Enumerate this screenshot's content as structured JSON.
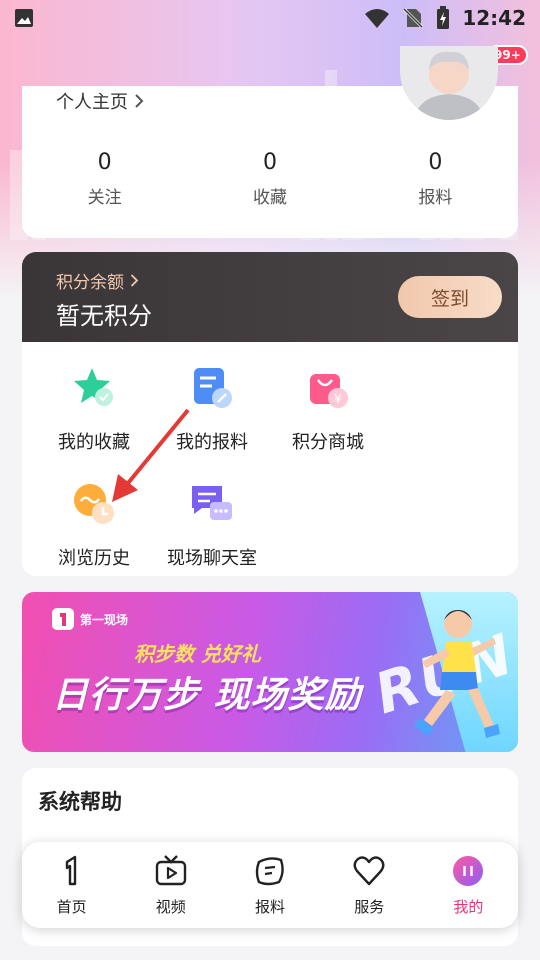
{
  "status_bar": {
    "time": "12:42"
  },
  "header": {
    "notification_badge": "99+"
  },
  "profile": {
    "home_link": "个人主页",
    "stats": [
      {
        "value": "0",
        "label": "关注"
      },
      {
        "value": "0",
        "label": "收藏"
      },
      {
        "value": "0",
        "label": "报料"
      }
    ]
  },
  "points": {
    "label": "积分余额",
    "value": "暂无积分",
    "sign_button": "签到"
  },
  "menu": [
    {
      "label": "我的收藏",
      "icon": "star-favorite-icon"
    },
    {
      "label": "我的报料",
      "icon": "report-edit-icon"
    },
    {
      "label": "积分商城",
      "icon": "shopping-bag-icon"
    },
    {
      "label": "浏览历史",
      "icon": "history-clock-icon"
    },
    {
      "label": "现场聊天室",
      "icon": "chat-room-icon"
    }
  ],
  "banner": {
    "logo_text": "第一现场",
    "subtitle": "积步数 兑好礼",
    "title": "日行万步 现场奖励",
    "run_text": "RUN"
  },
  "help": {
    "title": "系统帮助"
  },
  "tabbar": [
    {
      "label": "首页",
      "icon": "home-one-icon"
    },
    {
      "label": "视频",
      "icon": "tv-video-icon"
    },
    {
      "label": "报料",
      "icon": "report-icon"
    },
    {
      "label": "服务",
      "icon": "heart-service-icon"
    },
    {
      "label": "我的",
      "icon": "profile-icon",
      "active": true
    }
  ],
  "colors": {
    "accent": "#e7357a",
    "points_bg": "#3d3839",
    "gold": "#f3c9ad"
  }
}
